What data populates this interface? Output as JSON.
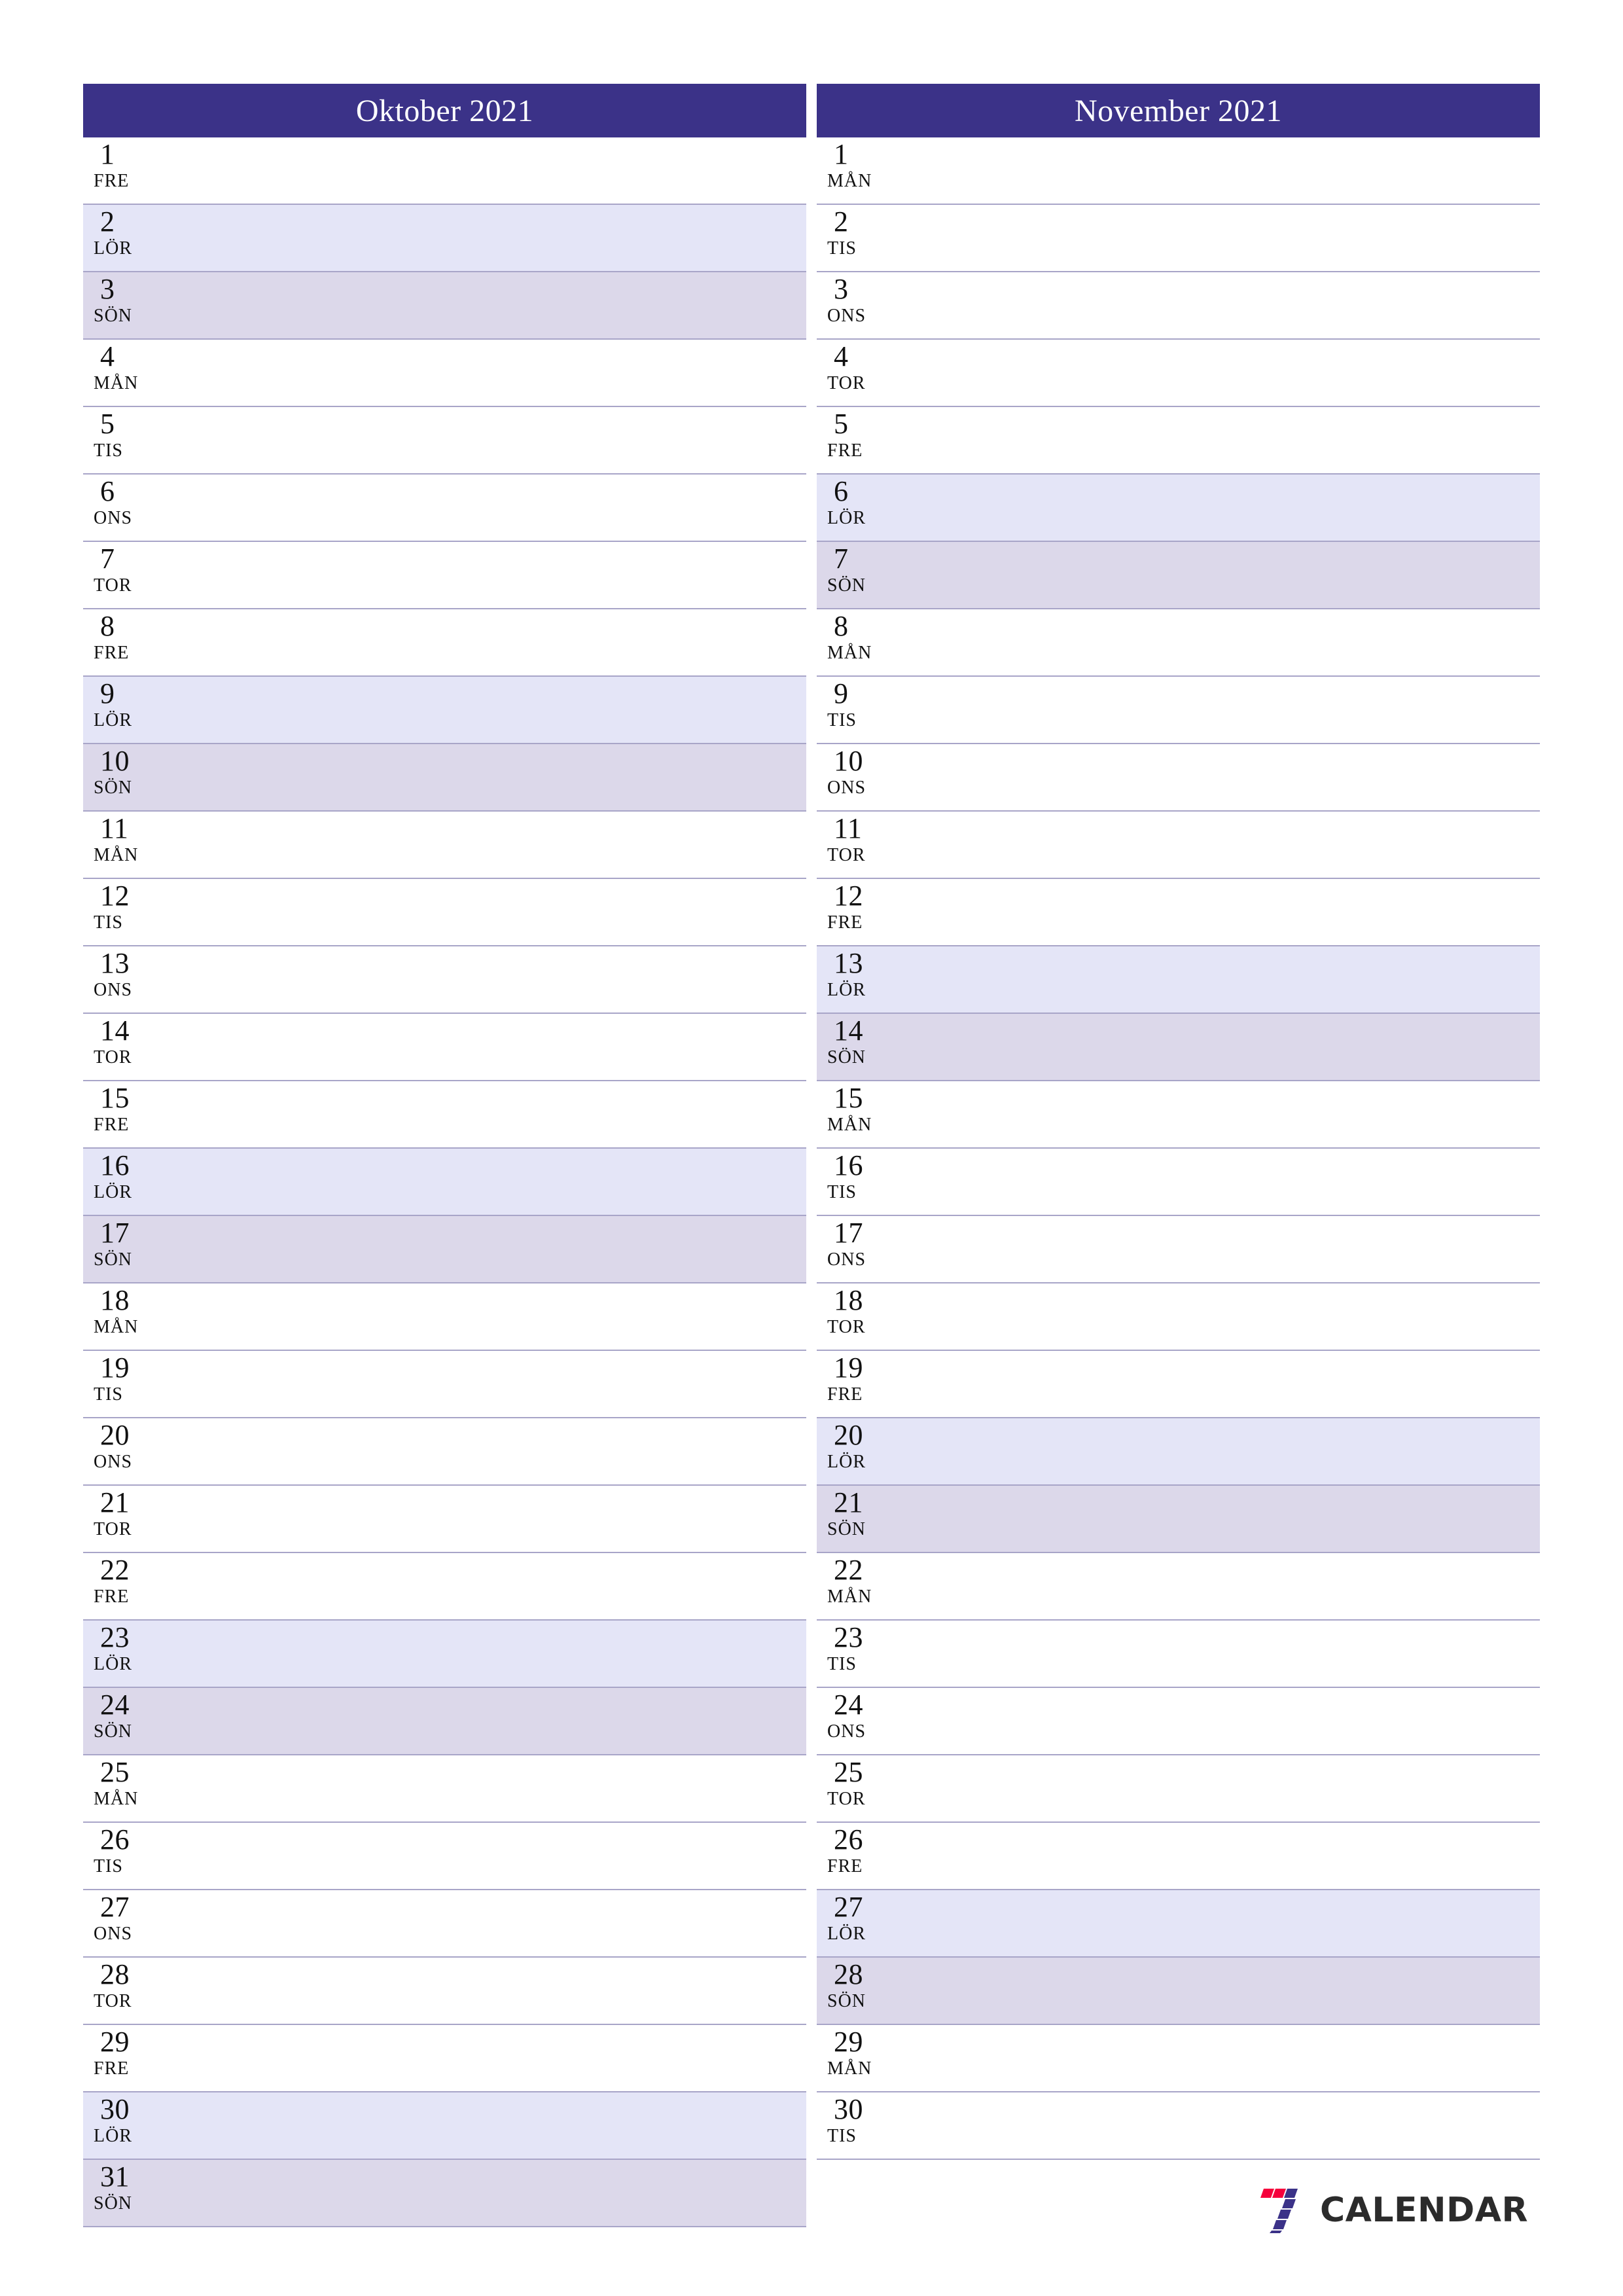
{
  "colors": {
    "header_bg": "#3b3288",
    "header_text": "#ffffff",
    "saturday_bg": "#e4e5f7",
    "sunday_bg": "#dcd8ea",
    "row_border": "#a8a5c8",
    "logo_red": "#f5003c",
    "logo_purple": "#3b3288",
    "logo_text": "#2b2b2b"
  },
  "brand": {
    "name": "CALENDAR",
    "logo_icon": "seven-logo-icon"
  },
  "months": [
    {
      "title": "Oktober 2021",
      "days": [
        {
          "num": "1",
          "abbr": "FRE",
          "type": "weekday"
        },
        {
          "num": "2",
          "abbr": "LÖR",
          "type": "sat"
        },
        {
          "num": "3",
          "abbr": "SÖN",
          "type": "sun"
        },
        {
          "num": "4",
          "abbr": "MÅN",
          "type": "weekday"
        },
        {
          "num": "5",
          "abbr": "TIS",
          "type": "weekday"
        },
        {
          "num": "6",
          "abbr": "ONS",
          "type": "weekday"
        },
        {
          "num": "7",
          "abbr": "TOR",
          "type": "weekday"
        },
        {
          "num": "8",
          "abbr": "FRE",
          "type": "weekday"
        },
        {
          "num": "9",
          "abbr": "LÖR",
          "type": "sat"
        },
        {
          "num": "10",
          "abbr": "SÖN",
          "type": "sun"
        },
        {
          "num": "11",
          "abbr": "MÅN",
          "type": "weekday"
        },
        {
          "num": "12",
          "abbr": "TIS",
          "type": "weekday"
        },
        {
          "num": "13",
          "abbr": "ONS",
          "type": "weekday"
        },
        {
          "num": "14",
          "abbr": "TOR",
          "type": "weekday"
        },
        {
          "num": "15",
          "abbr": "FRE",
          "type": "weekday"
        },
        {
          "num": "16",
          "abbr": "LÖR",
          "type": "sat"
        },
        {
          "num": "17",
          "abbr": "SÖN",
          "type": "sun"
        },
        {
          "num": "18",
          "abbr": "MÅN",
          "type": "weekday"
        },
        {
          "num": "19",
          "abbr": "TIS",
          "type": "weekday"
        },
        {
          "num": "20",
          "abbr": "ONS",
          "type": "weekday"
        },
        {
          "num": "21",
          "abbr": "TOR",
          "type": "weekday"
        },
        {
          "num": "22",
          "abbr": "FRE",
          "type": "weekday"
        },
        {
          "num": "23",
          "abbr": "LÖR",
          "type": "sat"
        },
        {
          "num": "24",
          "abbr": "SÖN",
          "type": "sun"
        },
        {
          "num": "25",
          "abbr": "MÅN",
          "type": "weekday"
        },
        {
          "num": "26",
          "abbr": "TIS",
          "type": "weekday"
        },
        {
          "num": "27",
          "abbr": "ONS",
          "type": "weekday"
        },
        {
          "num": "28",
          "abbr": "TOR",
          "type": "weekday"
        },
        {
          "num": "29",
          "abbr": "FRE",
          "type": "weekday"
        },
        {
          "num": "30",
          "abbr": "LÖR",
          "type": "sat"
        },
        {
          "num": "31",
          "abbr": "SÖN",
          "type": "sun"
        }
      ]
    },
    {
      "title": "November 2021",
      "days": [
        {
          "num": "1",
          "abbr": "MÅN",
          "type": "weekday"
        },
        {
          "num": "2",
          "abbr": "TIS",
          "type": "weekday"
        },
        {
          "num": "3",
          "abbr": "ONS",
          "type": "weekday"
        },
        {
          "num": "4",
          "abbr": "TOR",
          "type": "weekday"
        },
        {
          "num": "5",
          "abbr": "FRE",
          "type": "weekday"
        },
        {
          "num": "6",
          "abbr": "LÖR",
          "type": "sat"
        },
        {
          "num": "7",
          "abbr": "SÖN",
          "type": "sun"
        },
        {
          "num": "8",
          "abbr": "MÅN",
          "type": "weekday"
        },
        {
          "num": "9",
          "abbr": "TIS",
          "type": "weekday"
        },
        {
          "num": "10",
          "abbr": "ONS",
          "type": "weekday"
        },
        {
          "num": "11",
          "abbr": "TOR",
          "type": "weekday"
        },
        {
          "num": "12",
          "abbr": "FRE",
          "type": "weekday"
        },
        {
          "num": "13",
          "abbr": "LÖR",
          "type": "sat"
        },
        {
          "num": "14",
          "abbr": "SÖN",
          "type": "sun"
        },
        {
          "num": "15",
          "abbr": "MÅN",
          "type": "weekday"
        },
        {
          "num": "16",
          "abbr": "TIS",
          "type": "weekday"
        },
        {
          "num": "17",
          "abbr": "ONS",
          "type": "weekday"
        },
        {
          "num": "18",
          "abbr": "TOR",
          "type": "weekday"
        },
        {
          "num": "19",
          "abbr": "FRE",
          "type": "weekday"
        },
        {
          "num": "20",
          "abbr": "LÖR",
          "type": "sat"
        },
        {
          "num": "21",
          "abbr": "SÖN",
          "type": "sun"
        },
        {
          "num": "22",
          "abbr": "MÅN",
          "type": "weekday"
        },
        {
          "num": "23",
          "abbr": "TIS",
          "type": "weekday"
        },
        {
          "num": "24",
          "abbr": "ONS",
          "type": "weekday"
        },
        {
          "num": "25",
          "abbr": "TOR",
          "type": "weekday"
        },
        {
          "num": "26",
          "abbr": "FRE",
          "type": "weekday"
        },
        {
          "num": "27",
          "abbr": "LÖR",
          "type": "sat"
        },
        {
          "num": "28",
          "abbr": "SÖN",
          "type": "sun"
        },
        {
          "num": "29",
          "abbr": "MÅN",
          "type": "weekday"
        },
        {
          "num": "30",
          "abbr": "TIS",
          "type": "weekday"
        }
      ]
    }
  ]
}
